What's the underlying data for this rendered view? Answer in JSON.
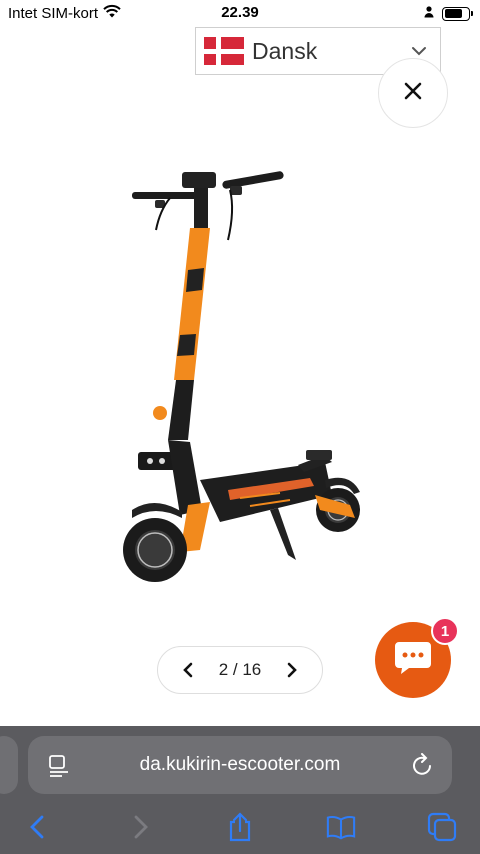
{
  "status_bar": {
    "carrier": "Intet SIM-kort",
    "time": "22.39",
    "battery_level": 0.75
  },
  "language_selector": {
    "flag": "denmark-flag",
    "label": "Dansk",
    "icon": "chevron-down-icon"
  },
  "gallery": {
    "image": "electric-scooter-orange-black",
    "current": 2,
    "total": 16,
    "counter_text": "2 / 16"
  },
  "chat": {
    "badge_count": "1",
    "color": "#e65a12",
    "badge_color": "#e8335a"
  },
  "browser": {
    "url": "da.kukirin-escooter.com",
    "toolbar_icons": [
      "back-icon",
      "forward-icon",
      "share-icon",
      "bookmarks-icon",
      "tabs-icon"
    ],
    "accent": "#2f7cf6"
  }
}
